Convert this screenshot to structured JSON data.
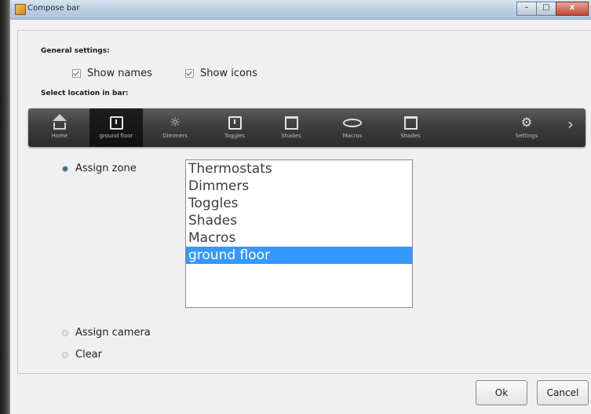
{
  "window": {
    "title": "Compose bar",
    "controls": {
      "minimize": "–",
      "maximize": "□",
      "close": "x"
    }
  },
  "general": {
    "heading": "General settings:",
    "show_names": {
      "label": "Show names",
      "checked": true
    },
    "show_icons": {
      "label": "Show icons",
      "checked": true
    }
  },
  "location": {
    "heading": "Select location in bar:"
  },
  "navbar": {
    "items": [
      {
        "label": "Home",
        "icon": "home-icon",
        "selected": false
      },
      {
        "label": "ground floor",
        "icon": "square-icon",
        "selected": true
      },
      {
        "label": "Dimmers",
        "icon": "sun-icon",
        "selected": false
      },
      {
        "label": "Toggles",
        "icon": "square-icon",
        "selected": false
      },
      {
        "label": "Shades",
        "icon": "shade-icon",
        "selected": false
      },
      {
        "label": "Macros",
        "icon": "oval-icon",
        "selected": false
      },
      {
        "label": "Shades",
        "icon": "shade-icon",
        "selected": false
      },
      {
        "label": "Settings",
        "icon": "gear-icon",
        "selected": false
      }
    ],
    "next_arrow": "›"
  },
  "options": {
    "assign_zone": "Assign zone",
    "assign_camera": "Assign camera",
    "clear": "Clear",
    "selected": "assign_zone"
  },
  "zone_list": {
    "items": [
      "Thermostats",
      "Dimmers",
      "Toggles",
      "Shades",
      "Macros",
      "ground floor"
    ],
    "selected_index": 5
  },
  "footer": {
    "ok": "Ok",
    "cancel": "Cancel"
  }
}
